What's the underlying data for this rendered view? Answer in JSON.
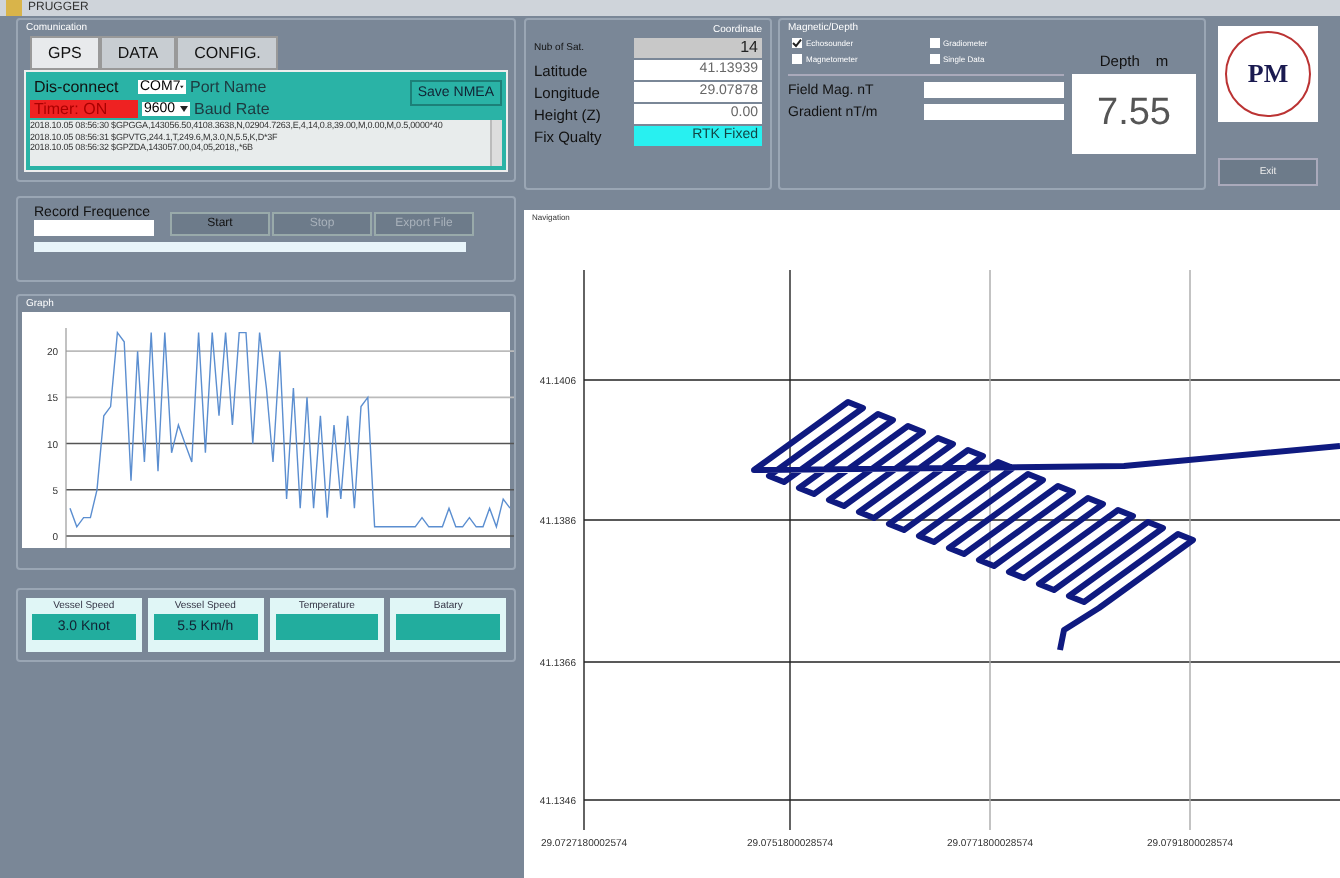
{
  "window": {
    "title": "PRUGGER"
  },
  "communication": {
    "title": "Comunication",
    "tabs": [
      {
        "label": "GPS",
        "selected": true
      },
      {
        "label": "DATA",
        "selected": false
      },
      {
        "label": "CONFIG.",
        "selected": false
      }
    ],
    "disconnect_button": "Dis-connect",
    "port": "COM7",
    "port_label": "Port Name",
    "timer": {
      "label": "Timer: ON",
      "on": true
    },
    "baud": "9600",
    "baud_label": "Baud Rate",
    "save_button": "Save NMEA",
    "log": [
      "2018.10.05 08:56:30 $GPGGA,143056.50,4108.3638,N,02904.7263,E,4,14,0.8,39.00,M,0.00,M,0.5,0000*40",
      "2018.10.05 08:56:31 $GPVTG,244.1,T,249.6,M,3.0,N,5.5,K,D*3F",
      "2018.10.05 08:56:32 $GPZDA,143057.00,04,05,2018,,*6B"
    ]
  },
  "coordinate": {
    "title": "Coordinate",
    "fields": [
      {
        "label": "Nub of Sat.",
        "value": "14",
        "kind": "count"
      },
      {
        "label": "Latitude",
        "value": "41.13939",
        "kind": "value"
      },
      {
        "label": "Longitude",
        "value": "29.07878",
        "kind": "value"
      },
      {
        "label": "Height (Z)",
        "value": "0.00",
        "kind": "value"
      },
      {
        "label": "Fix Qualty",
        "value": "RTK Fixed",
        "kind": "status"
      }
    ]
  },
  "magnetic": {
    "title": "Magnetic/Depth",
    "options": [
      {
        "label": "Echosounder",
        "checked": true
      },
      {
        "label": "Gradiometer",
        "checked": false
      },
      {
        "label": "Magnetometer",
        "checked": false
      },
      {
        "label": "Single Data",
        "checked": false
      }
    ],
    "fields": [
      {
        "label": "Field Mag. nT"
      },
      {
        "label": "Gradient nT/m"
      }
    ],
    "depth": {
      "label": "Depth",
      "unit": "m",
      "value": "7.55"
    }
  },
  "logo": {
    "text": "PM"
  },
  "exit_button": "Exit",
  "record": {
    "label": "Record Frequence",
    "progress": {
      "level": 0
    },
    "buttons": [
      {
        "label": "Start",
        "disabled": false
      },
      {
        "label": "Stop",
        "disabled": true
      },
      {
        "label": "Export File",
        "disabled": true
      }
    ]
  },
  "graph": {
    "title": "Graph",
    "chart_data": {
      "type": "line",
      "ylim": [
        0,
        22.5
      ],
      "yticks": [
        0,
        5,
        10,
        15,
        20
      ],
      "grid": true,
      "series": [
        {
          "color": "#5b8ed0",
          "values": [
            3,
            1,
            2,
            2,
            5,
            13,
            14,
            22,
            21,
            6,
            20,
            8,
            22,
            7,
            22,
            9,
            12,
            10,
            8,
            22,
            9,
            22,
            13,
            22,
            12,
            22,
            22,
            10,
            22,
            16,
            8,
            20,
            4,
            16,
            3,
            15,
            3,
            13,
            2,
            12,
            4,
            13,
            3,
            14,
            15,
            1,
            1,
            1,
            1,
            1,
            1,
            1,
            2,
            1,
            1,
            1,
            3,
            1,
            1,
            2,
            1,
            1,
            3,
            1,
            4,
            3
          ]
        }
      ]
    }
  },
  "gauges": [
    {
      "label": "Vessel Speed",
      "value": "3.0  Knot"
    },
    {
      "label": "Vessel Speed",
      "value": "5.5  Km/h"
    },
    {
      "label": "Temperature"
    },
    {
      "label": "Batary"
    }
  ],
  "navigation": {
    "title": "Navigation",
    "y_labels": [
      "41.1406",
      "41.1386",
      "41.1366",
      "41.1346"
    ],
    "x_labels": [
      "29.0727180002574",
      "29.0751800028574",
      "29.0771800028574",
      "29.0791800028574"
    ]
  }
}
